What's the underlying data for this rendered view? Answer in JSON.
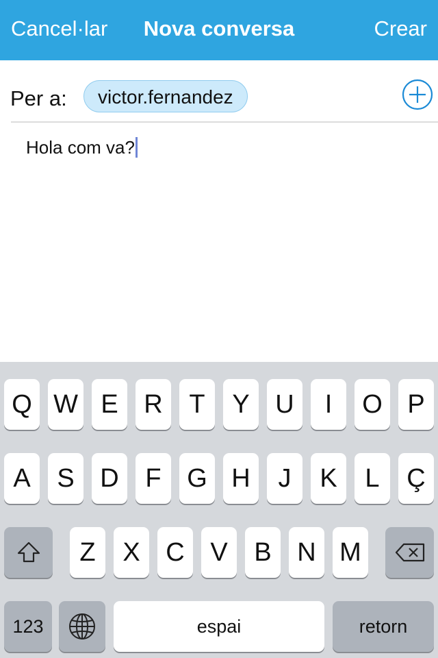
{
  "navbar": {
    "cancel_label": "Cancel·lar",
    "title": "Nova conversa",
    "create_label": "Crear",
    "color": "#2fa5e0"
  },
  "recipient": {
    "label": "Per a:",
    "chip": "victor.fernandez",
    "add_icon": "plus-circle-icon"
  },
  "message": {
    "text": "Hola com va?"
  },
  "keyboard": {
    "row1": [
      "Q",
      "W",
      "E",
      "R",
      "T",
      "Y",
      "U",
      "I",
      "O",
      "P"
    ],
    "row2": [
      "A",
      "S",
      "D",
      "F",
      "G",
      "H",
      "J",
      "K",
      "L",
      "Ç"
    ],
    "row3": [
      "Z",
      "X",
      "C",
      "V",
      "B",
      "N",
      "M"
    ],
    "shift_icon": "shift-icon",
    "backspace_icon": "backspace-icon",
    "numbers_label": "123",
    "globe_icon": "globe-icon",
    "space_label": "espai",
    "return_label": "retorn"
  }
}
